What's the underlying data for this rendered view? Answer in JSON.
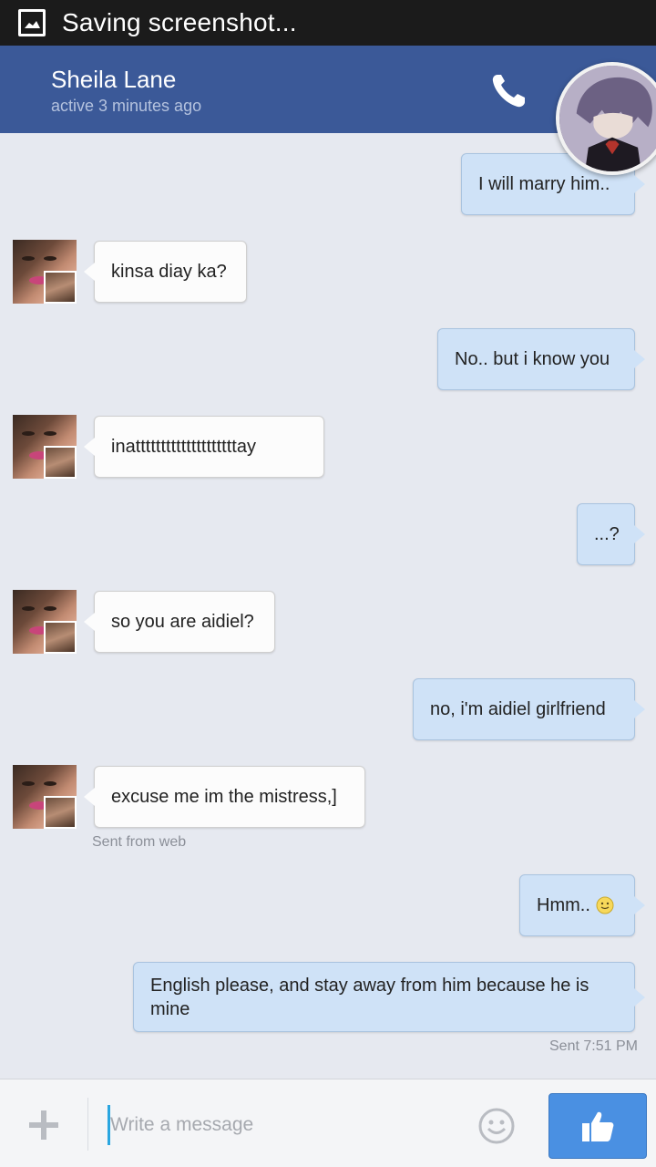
{
  "status_bar": {
    "text": "Saving screenshot..."
  },
  "header": {
    "name": "Sheila Lane",
    "active": "active 3 minutes ago"
  },
  "messages": [
    {
      "dir": "out",
      "text": "I will marry him.."
    },
    {
      "dir": "in",
      "text": "kinsa diay ka?"
    },
    {
      "dir": "out",
      "text": "No.. but i know you"
    },
    {
      "dir": "in",
      "text": "inattttttttttttttttttttay"
    },
    {
      "dir": "out",
      "text": "...?"
    },
    {
      "dir": "in",
      "text": "so you are aidiel?"
    },
    {
      "dir": "out",
      "text": "no, i'm aidiel girlfriend"
    },
    {
      "dir": "in",
      "text": "excuse me im the mistress,]",
      "meta": "Sent from web"
    },
    {
      "dir": "out",
      "text": "Hmm..",
      "emoji": "slightly-smiling-face"
    },
    {
      "dir": "out",
      "text": "English please, and stay away from him because he is mine",
      "meta": "Sent 7:51 PM"
    }
  ],
  "composer": {
    "placeholder": "Write a message"
  },
  "colors": {
    "header": "#3b5998",
    "outgoing_bubble": "#cfe2f7",
    "incoming_bubble": "#fcfcfc",
    "like_button": "#4a90e2"
  },
  "icons": [
    "screenshot-icon",
    "phone-icon",
    "plus-icon",
    "emoji-icon",
    "thumbs-up-icon"
  ]
}
